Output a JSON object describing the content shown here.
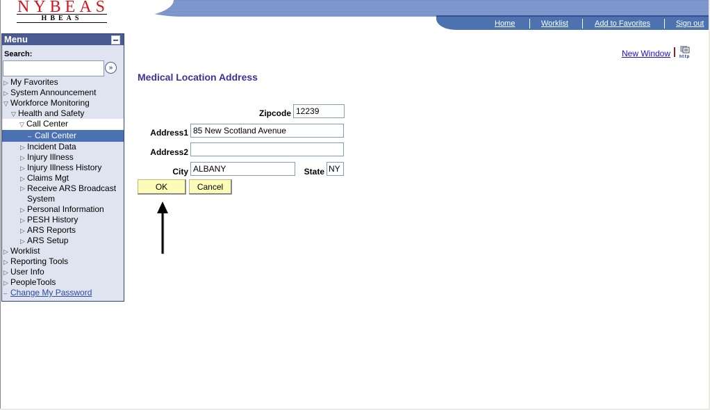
{
  "logo": {
    "title": "NYBEAS",
    "subtitle": "HBEAS"
  },
  "nav": {
    "links": [
      "Home",
      "Worklist",
      "Add to Favorites",
      "Sign out"
    ]
  },
  "menu": {
    "title": "Menu",
    "search_label": "Search:",
    "search_value": "",
    "items": [
      {
        "label": "My Favorites",
        "state": "collapsed"
      },
      {
        "label": "System Announcement",
        "state": "collapsed"
      },
      {
        "label": "Workforce Monitoring",
        "state": "expanded"
      },
      {
        "label": "Health and Safety",
        "state": "expanded"
      },
      {
        "label": "Call Center",
        "state": "expanded"
      },
      {
        "label": "Call Center",
        "state": "selected"
      },
      {
        "label": "Incident Data",
        "state": "collapsed"
      },
      {
        "label": "Injury Illness",
        "state": "collapsed"
      },
      {
        "label": "Injury Illness History",
        "state": "collapsed"
      },
      {
        "label": "Claims Mgt",
        "state": "collapsed"
      },
      {
        "label": "Receive ARS Broadcast System",
        "state": "collapsed"
      },
      {
        "label": "Personal Information",
        "state": "collapsed"
      },
      {
        "label": "PESH History",
        "state": "collapsed"
      },
      {
        "label": "ARS Reports",
        "state": "collapsed"
      },
      {
        "label": "ARS Setup",
        "state": "collapsed"
      },
      {
        "label": "Worklist",
        "state": "collapsed"
      },
      {
        "label": "Reporting Tools",
        "state": "collapsed"
      },
      {
        "label": "User Info",
        "state": "collapsed"
      },
      {
        "label": "PeopleTools",
        "state": "collapsed"
      },
      {
        "label": "Change My Password",
        "state": "link"
      }
    ]
  },
  "toolbar": {
    "new_window": "New Window",
    "http_icon_label": "http"
  },
  "form": {
    "title": "Medical Location Address",
    "fields": {
      "zipcode": {
        "label": "Zipcode",
        "value": "12239"
      },
      "address1": {
        "label": "Address1",
        "value": "85 New Scotland Avenue"
      },
      "address2": {
        "label": "Address2",
        "value": ""
      },
      "city": {
        "label": "City",
        "value": "ALBANY"
      },
      "state": {
        "label": "State",
        "value": "NY"
      }
    },
    "ok_label": "OK",
    "cancel_label": "Cancel"
  },
  "colors": {
    "brand_red": "#d8141b",
    "menu_header": "#4b5c92",
    "nav_bar": "#4c73b0",
    "title": "#37339a",
    "button_bg": "#fcfcb8"
  }
}
